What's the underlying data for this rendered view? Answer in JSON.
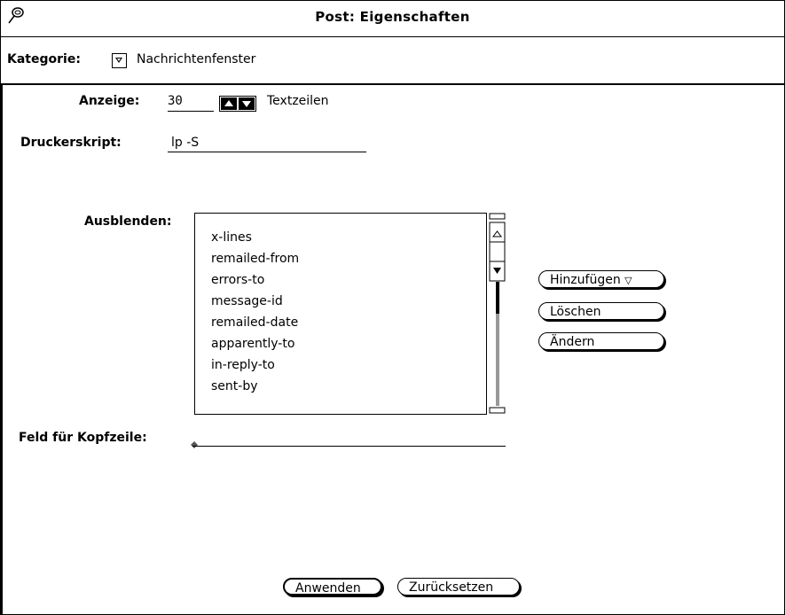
{
  "window": {
    "title": "Post: Eigenschaften"
  },
  "category": {
    "label": "Kategorie:",
    "value": "Nachrichtenfenster"
  },
  "display": {
    "label": "Anzeige:",
    "value": "30",
    "suffix": "Textzeilen"
  },
  "printer": {
    "label": "Druckerskript:",
    "value": "lp -S"
  },
  "hide": {
    "label": "Ausblenden:",
    "items": [
      "x-lines",
      "remailed-from",
      "errors-to",
      "message-id",
      "remailed-date",
      "apparently-to",
      "in-reply-to",
      "sent-by"
    ]
  },
  "buttons": {
    "add": "Hinzufügen",
    "delete": "Löschen",
    "change": "Ändern",
    "apply": "Anwenden",
    "reset": "Zurücksetzen"
  },
  "header_field": {
    "label": "Feld für Kopfzeile:",
    "value": ""
  }
}
